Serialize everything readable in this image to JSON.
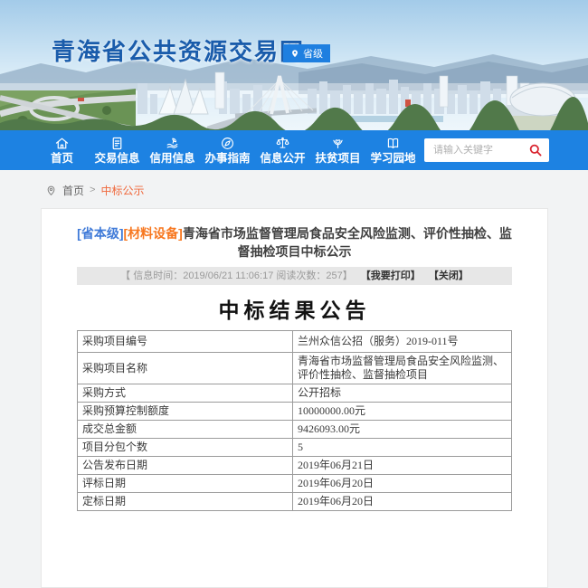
{
  "banner": {
    "site_title": "青海省公共资源交易网",
    "badge_label": "省级"
  },
  "nav": {
    "items": [
      {
        "label": "首页",
        "icon": "home-icon"
      },
      {
        "label": "交易信息",
        "icon": "document-icon"
      },
      {
        "label": "信用信息",
        "icon": "hand-leaf-icon"
      },
      {
        "label": "办事指南",
        "icon": "compass-icon"
      },
      {
        "label": "信息公开",
        "icon": "scales-icon"
      },
      {
        "label": "扶贫项目",
        "icon": "person-heart-icon"
      },
      {
        "label": "学习园地",
        "icon": "book-icon"
      }
    ],
    "search_placeholder": "请输入关键字"
  },
  "breadcrumb": {
    "home": "首页",
    "separator": ">",
    "current": "中标公示"
  },
  "article": {
    "title_prefix_level": "[省本级]",
    "title_prefix_category": "[材料设备]",
    "title_main": "青海省市场监督管理局食品安全风险监测、评价性抽检、监督抽检项目中标公示",
    "meta_info": "【 信息时间：2019/06/21 11:06:17  阅读次数：257】",
    "print_label": "【我要打印】",
    "close_label": "【关闭】",
    "notice_heading": "中标结果公告"
  },
  "table": {
    "rows": [
      {
        "label": "采购项目编号",
        "value": "兰州众信公招（服务）2019-011号"
      },
      {
        "label": "采购项目名称",
        "value": "青海省市场监督管理局食品安全风险监测、评价性抽检、监督抽检项目"
      },
      {
        "label": "采购方式",
        "value": "公开招标"
      },
      {
        "label": "采购预算控制额度",
        "value": "10000000.00元"
      },
      {
        "label": "成交总金额",
        "value": "9426093.00元"
      },
      {
        "label": "项目分包个数",
        "value": "5"
      },
      {
        "label": "公告发布日期",
        "value": "2019年06月21日"
      },
      {
        "label": "评标日期",
        "value": "2019年06月20日"
      },
      {
        "label": "定标日期",
        "value": "2019年06月20日"
      }
    ]
  },
  "colors": {
    "nav_blue": "#1d82e2",
    "badge_blue": "#1e7fe0",
    "site_title_blue": "#1a5cab",
    "tag_blue": "#3f7ad8",
    "tag_orange": "#f7771f",
    "breadcrumb_orange": "#f0683c",
    "search_icon_red": "#d9232e"
  }
}
